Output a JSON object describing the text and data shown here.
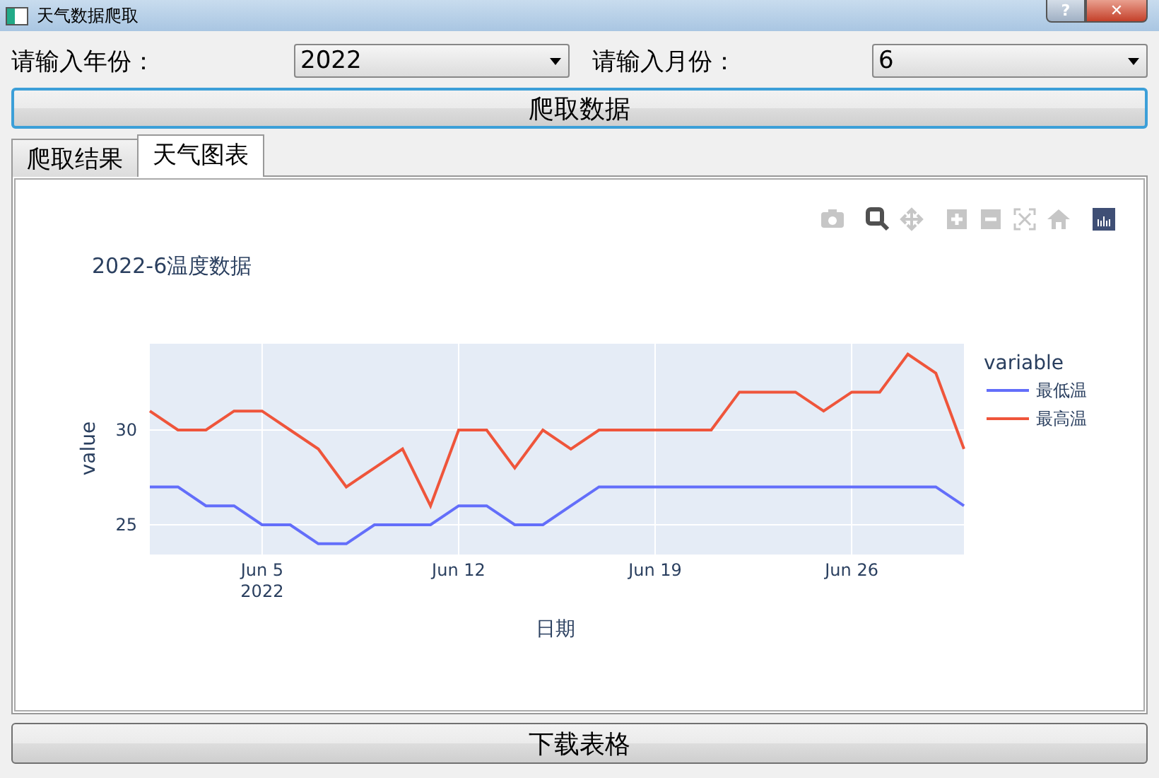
{
  "window": {
    "title": "天气数据爬取",
    "buttons": [
      {
        "kind": "help",
        "label": "?"
      },
      {
        "kind": "close",
        "label": "✕"
      }
    ]
  },
  "form": {
    "year_label": "请输入年份：",
    "year": "2022",
    "month_label": "请输入月份：",
    "month": "6"
  },
  "fetch_button": "爬取数据",
  "tabs": [
    {
      "label": "爬取结果",
      "selected": false
    },
    {
      "label": "天气图表",
      "selected": true
    }
  ],
  "chart": {
    "modebar": [
      {
        "kind": "camera",
        "selected": false
      },
      {
        "kind": "zoom",
        "selected": true
      },
      {
        "kind": "pan",
        "selected": false
      },
      {
        "kind": "zoom-in",
        "selected": false
      },
      {
        "kind": "zoom-out",
        "selected": false
      },
      {
        "kind": "autoscale",
        "selected": false
      },
      {
        "kind": "home",
        "selected": false
      },
      {
        "kind": "logo",
        "selected": false
      }
    ],
    "chart_data": {
      "type": "line",
      "title": "2022-6温度数据",
      "xlabel": "日期",
      "ylabel": "value",
      "categories": [
        null,
        null,
        null,
        null,
        "Jun 5\n2022",
        null,
        null,
        null,
        null,
        null,
        null,
        "Jun 12",
        null,
        null,
        null,
        null,
        null,
        null,
        "Jun 19",
        null,
        null,
        null,
        null,
        null,
        null,
        "Jun 26",
        null,
        null,
        null,
        null
      ],
      "series": [
        {
          "name": "最低温",
          "color": "#636efa",
          "values": [
            27,
            27,
            26,
            26,
            25,
            25,
            24,
            24,
            25,
            25,
            25,
            26,
            26,
            25,
            25,
            26,
            27,
            27,
            27,
            27,
            27,
            27,
            27,
            27,
            27,
            27,
            27,
            27,
            27,
            26
          ]
        },
        {
          "name": "最高温",
          "color": "#ef553b",
          "values": [
            31,
            30,
            30,
            31,
            31,
            30,
            29,
            27,
            28,
            29,
            26,
            30,
            30,
            28,
            30,
            29,
            30,
            30,
            30,
            30,
            30,
            32,
            32,
            32,
            31,
            32,
            32,
            34,
            33,
            29
          ]
        }
      ],
      "ylim": [
        23.43,
        34.55
      ],
      "grid": true,
      "legend": {
        "title": "variable"
      },
      "yticks": [
        25,
        30
      ]
    }
  },
  "download_button": "下载表格"
}
